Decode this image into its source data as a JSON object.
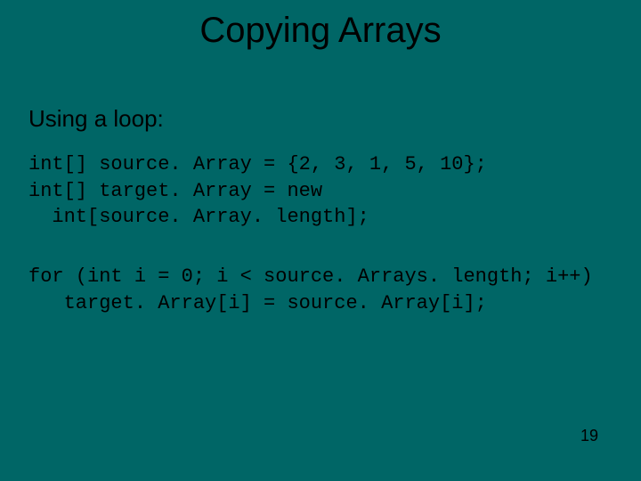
{
  "title": "Copying Arrays",
  "subtitle": "Using a loop:",
  "code_block_1": "int[] source. Array = {2, 3, 1, 5, 10};\nint[] target. Array = new\n  int[source. Array. length];",
  "code_block_2": "for (int i = 0; i < source. Arrays. length; i++)\n   target. Array[i] = source. Array[i];",
  "page_number": "19"
}
